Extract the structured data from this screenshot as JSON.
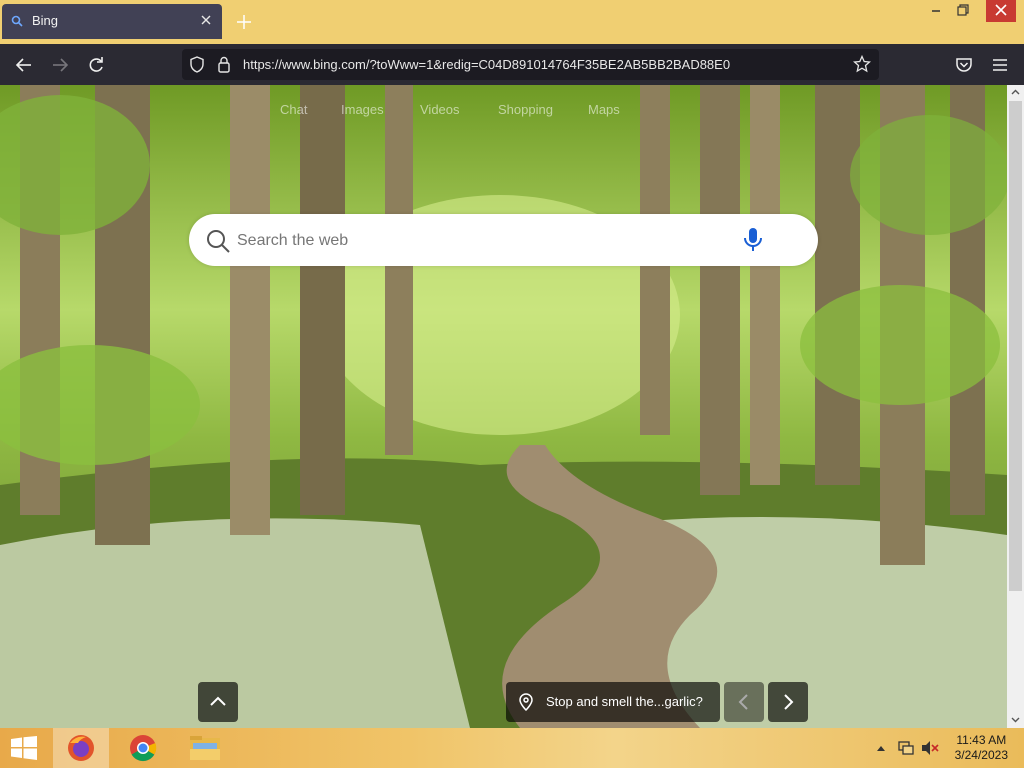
{
  "browser": {
    "tab_title": "Bing",
    "url": "https://www.bing.com/?toWww=1&redig=C04D891014764F35BE2AB5BB2BAD88E0"
  },
  "bing": {
    "nav": [
      "Chat",
      "Images",
      "Videos",
      "Shopping",
      "Maps"
    ],
    "search_placeholder": "Search the web",
    "image_caption": "Stop and smell the...garlic?"
  },
  "taskbar": {
    "time": "11:43 AM",
    "date": "3/24/2023"
  },
  "colors": {
    "tabstrip": "#f0cf72",
    "navbar": "#2b2a33",
    "tab_active": "#414155",
    "close_red": "#c83a32"
  }
}
